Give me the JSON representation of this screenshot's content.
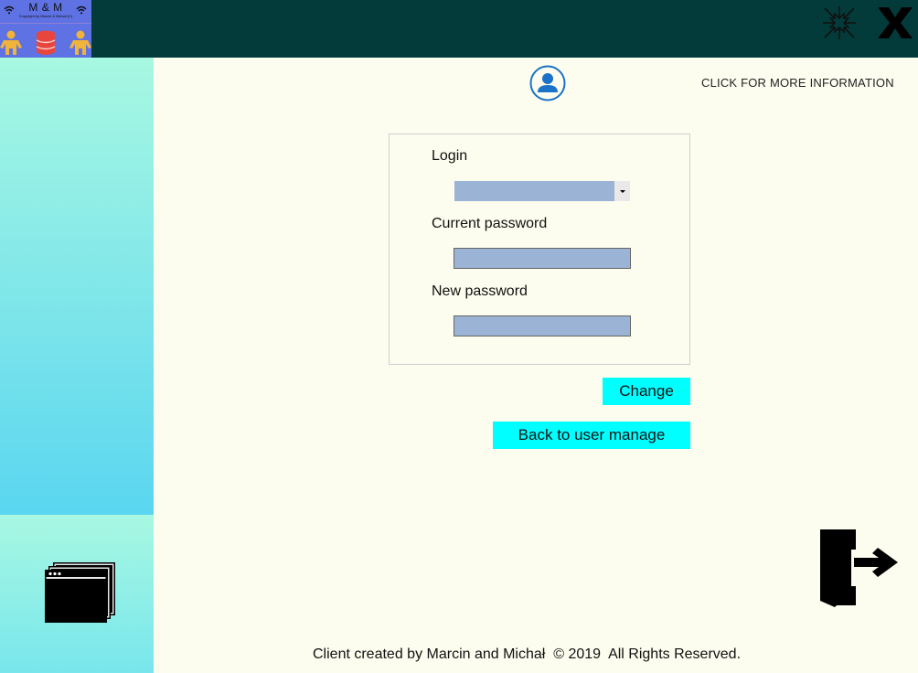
{
  "logo": {
    "title": "M & M",
    "subtitle": "Copyright by Marcin & Michał (C)",
    "icons": [
      "wifi-icon",
      "person-icon",
      "database-icon"
    ]
  },
  "window_controls": {
    "minimize_icon": "compress-arrows-icon",
    "close_icon": "close-x-icon"
  },
  "header": {
    "user_icon": "user-circle-icon",
    "more_info_label": "CLICK FOR MORE INFORMATION"
  },
  "form": {
    "login_label": "Login",
    "login_value": "",
    "current_password_label": "Current password",
    "current_password_value": "",
    "new_password_label": "New password",
    "new_password_value": ""
  },
  "buttons": {
    "change_label": "Change",
    "back_label": "Back to user manage"
  },
  "sidebar": {
    "windows_icon": "stacked-windows-icon"
  },
  "exit_icon": "exit-door-icon",
  "footer": {
    "text": "Client created by Marcin and Michał  © 2019  All Rights Reserved."
  },
  "colors": {
    "topbar": "#033b3b",
    "logo_bg": "#5e72e4",
    "page_bg": "#fdfdef",
    "input_bg": "#9bb3d4",
    "button_bg": "#00ffff",
    "sidebar_gradient_top": "#a8f8e2",
    "sidebar_gradient_bottom": "#5ad6f0"
  }
}
